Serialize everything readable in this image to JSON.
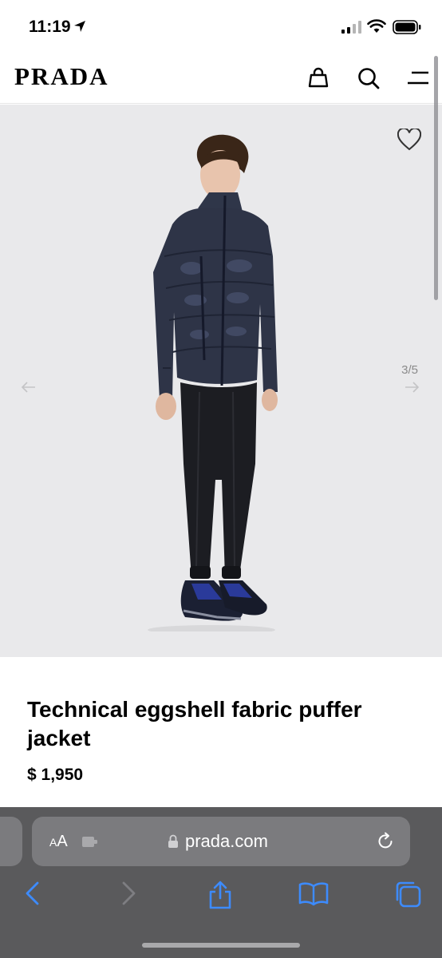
{
  "status_bar": {
    "time": "11:19",
    "icons": [
      "location-arrow-icon",
      "signal-icon",
      "wifi-icon",
      "battery-icon"
    ]
  },
  "header": {
    "logo": "PRADA",
    "icons": [
      "shopping-bag-icon",
      "search-icon",
      "menu-icon"
    ]
  },
  "gallery": {
    "counter": "3/5",
    "current_image": 3,
    "total_images": 5,
    "background": "#e9e9eb"
  },
  "product": {
    "title": "Technical eggshell fabric puffer jacket",
    "price": "$ 1,950"
  },
  "browser": {
    "aa_small": "A",
    "aa_large": "A",
    "url": "prada.com"
  },
  "colors": {
    "accent": "#3d8bfd",
    "toolbar_bg": "#5a5a5c",
    "pill_bg": "#7b7b7e"
  }
}
